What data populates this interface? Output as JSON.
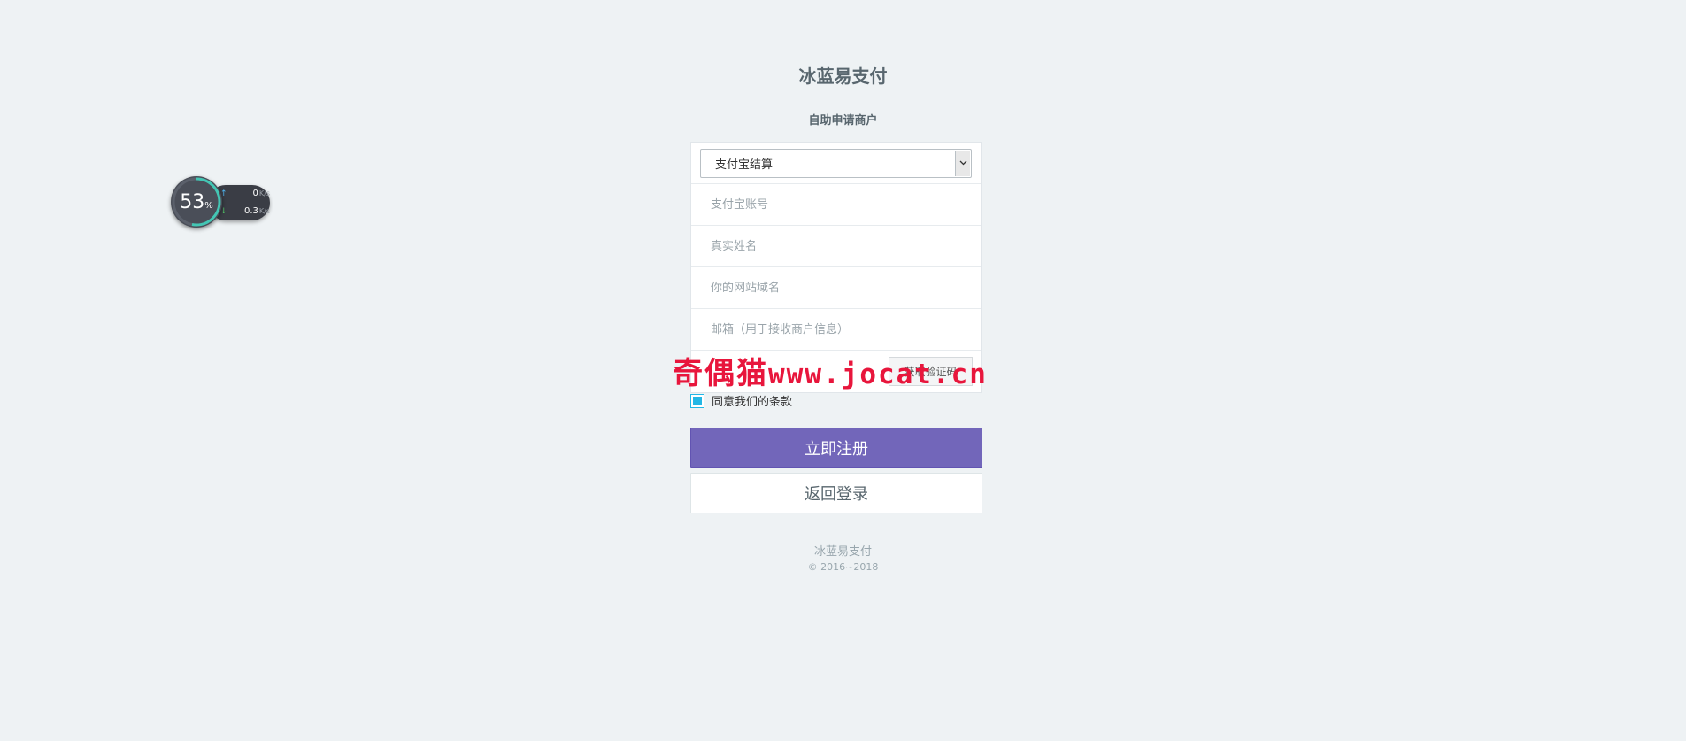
{
  "site": {
    "title": "冰蓝易支付"
  },
  "page": {
    "subtitle": "自助申请商户"
  },
  "form": {
    "settlement_select": {
      "value": "支付宝结算"
    },
    "alipay_account": {
      "placeholder": "支付宝账号"
    },
    "real_name": {
      "placeholder": "真实姓名"
    },
    "website_domain": {
      "placeholder": "你的网站域名"
    },
    "email": {
      "placeholder": "邮箱（用于接收商户信息）"
    },
    "verification": {
      "placeholder": "",
      "button_label": "获取验证码"
    },
    "agree": {
      "label": "同意我们的条款",
      "checked": true
    },
    "register_button": "立即注册",
    "back_to_login_button": "返回登录"
  },
  "footer": {
    "name": "冰蓝易支付",
    "copyright": "© 2016~2018"
  },
  "watermark": {
    "brand": "奇偶猫",
    "url": "www.jocat.cn"
  },
  "net_widget": {
    "percent": "53",
    "percent_sign": "%",
    "upload": "0",
    "download": "0.3",
    "unit": "K/s",
    "level": 0.53
  },
  "colors": {
    "background": "#eef2f4",
    "accent_purple": "#7266ba",
    "checkbox_blue": "#23b7e5",
    "watermark_red": "#e8163c"
  },
  "icons": {
    "select_arrow": "chevron-down-icon",
    "upload": "arrow-up-icon",
    "download": "arrow-down-icon"
  }
}
